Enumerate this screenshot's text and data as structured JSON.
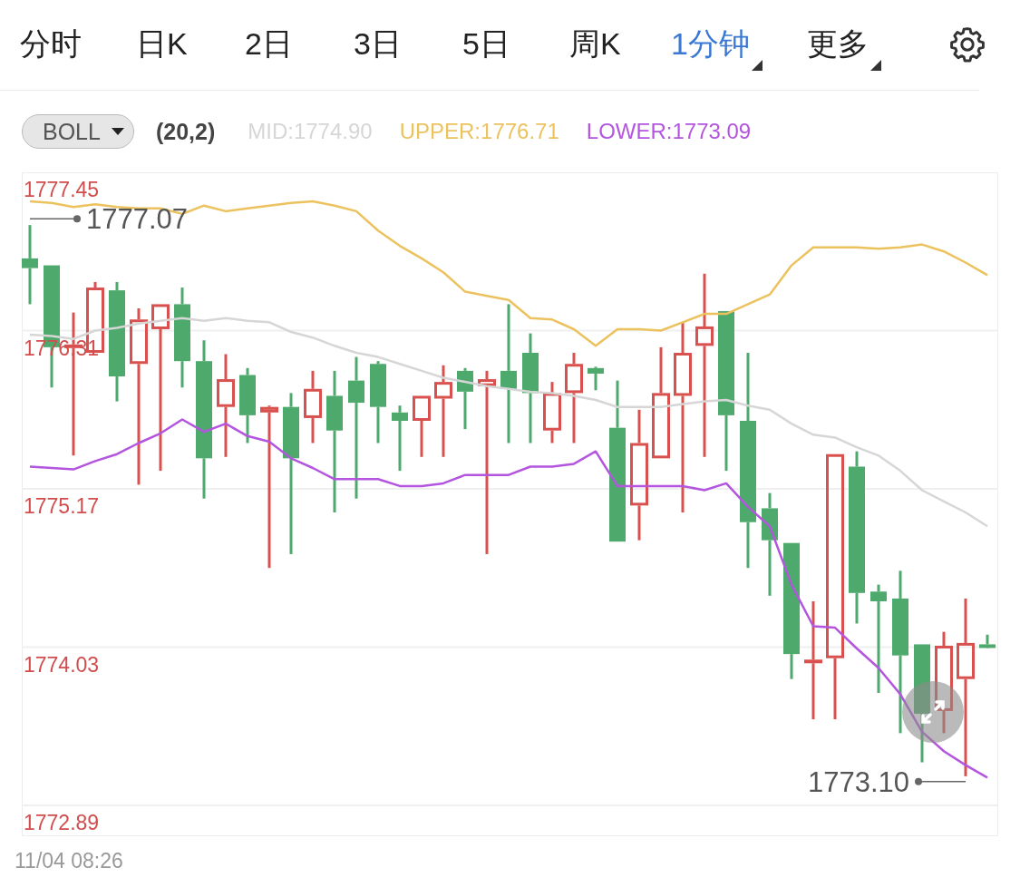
{
  "tabs": [
    {
      "label": "分时",
      "selected": false,
      "dropdown": false
    },
    {
      "label": "日K",
      "selected": false,
      "dropdown": false
    },
    {
      "label": "2日",
      "selected": false,
      "dropdown": false
    },
    {
      "label": "3日",
      "selected": false,
      "dropdown": false
    },
    {
      "label": "5日",
      "selected": false,
      "dropdown": false
    },
    {
      "label": "周K",
      "selected": false,
      "dropdown": false
    },
    {
      "label": "1分钟",
      "selected": true,
      "dropdown": true
    },
    {
      "label": "更多",
      "selected": false,
      "dropdown": true
    }
  ],
  "indicator": {
    "selector": "BOLL",
    "params": "(20,2)",
    "readings": [
      {
        "label": "MID:1774.90",
        "color": "#d6d6d6"
      },
      {
        "label": "UPPER:1776.71",
        "color": "#ecc25e"
      },
      {
        "label": "LOWER:1773.09",
        "color": "#b455e0"
      }
    ]
  },
  "chart": {
    "chart_data": {
      "type": "line",
      "ylim": [
        1772.89,
        1777.45
      ],
      "grid": true,
      "yticks": [
        {
          "value": 1777.45,
          "label": "1777.45"
        },
        {
          "value": 1776.31,
          "label": "1776.31"
        },
        {
          "value": 1775.17,
          "label": "1775.17"
        },
        {
          "value": 1774.03,
          "label": "1774.03"
        },
        {
          "value": 1772.89,
          "label": "1772.89"
        }
      ],
      "series": [
        {
          "color": "#ecc25e",
          "values": [
            1777.24,
            1777.23,
            1777.2,
            1777.22,
            1777.2,
            1777.19,
            1777.19,
            1777.15,
            1777.21,
            1777.17,
            1777.19,
            1777.21,
            1777.23,
            1777.24,
            1777.21,
            1777.17,
            1777.03,
            1776.92,
            1776.83,
            1776.73,
            1776.59,
            1776.56,
            1776.53,
            1776.4,
            1776.39,
            1776.32,
            1776.2,
            1776.32,
            1776.32,
            1776.31,
            1776.37,
            1776.43,
            1776.43,
            1776.5,
            1776.57,
            1776.78,
            1776.91,
            1776.91,
            1776.91,
            1776.9,
            1776.91,
            1776.93,
            1776.88,
            1776.8,
            1776.71
          ]
        },
        {
          "color": "#d6d6d6",
          "values": [
            1776.28,
            1776.27,
            1776.25,
            1776.31,
            1776.33,
            1776.36,
            1776.38,
            1776.4,
            1776.38,
            1776.4,
            1776.38,
            1776.37,
            1776.3,
            1776.26,
            1776.2,
            1776.15,
            1776.12,
            1776.07,
            1776.02,
            1775.97,
            1775.94,
            1775.91,
            1775.89,
            1775.87,
            1775.86,
            1775.84,
            1775.81,
            1775.76,
            1775.76,
            1775.76,
            1775.78,
            1775.8,
            1775.81,
            1775.77,
            1775.74,
            1775.64,
            1775.56,
            1775.54,
            1775.47,
            1775.41,
            1775.3,
            1775.16,
            1775.08,
            1775.0,
            1774.9
          ]
        },
        {
          "color": "#b455e0",
          "values": [
            1775.33,
            1775.32,
            1775.31,
            1775.37,
            1775.42,
            1775.5,
            1775.57,
            1775.67,
            1775.58,
            1775.64,
            1775.55,
            1775.51,
            1775.39,
            1775.32,
            1775.24,
            1775.24,
            1775.24,
            1775.19,
            1775.19,
            1775.21,
            1775.27,
            1775.27,
            1775.27,
            1775.33,
            1775.33,
            1775.35,
            1775.44,
            1775.19,
            1775.19,
            1775.19,
            1775.19,
            1775.16,
            1775.21,
            1775.04,
            1774.9,
            1774.48,
            1774.18,
            1774.17,
            1774.02,
            1773.88,
            1773.69,
            1773.42,
            1773.28,
            1773.18,
            1773.09
          ]
        }
      ],
      "annotations": [
        "1777.07",
        "1773.10"
      ]
    }
  },
  "footer": {
    "time": "11/04 08:26"
  }
}
